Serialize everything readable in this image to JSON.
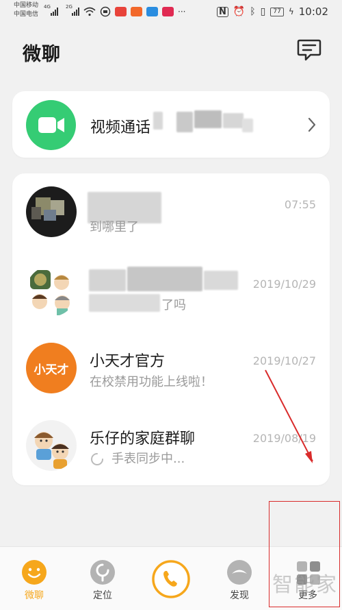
{
  "status_bar": {
    "carrier_1": "中国移动",
    "carrier_2": "中国电信",
    "network_1": "4G",
    "network_2": "2G",
    "more": "···",
    "battery": "77",
    "time": "10:02"
  },
  "header": {
    "title": "微聊",
    "compose_icon": "message-compose-icon"
  },
  "video_call": {
    "label": "视频通话",
    "icon": "video-camera-icon",
    "accent": "#35cc74"
  },
  "chats": [
    {
      "name": "",
      "last_message": "到哪里了",
      "time": "07:55"
    },
    {
      "name": "",
      "last_message": "了吗",
      "time": "2019/10/29"
    },
    {
      "name": "小天才官方",
      "last_message": "在校禁用功能上线啦！",
      "time": "2019/10/27",
      "avatar_text": "小天才",
      "avatar_color": "#f07e1f"
    },
    {
      "name": "乐仔的家庭群聊",
      "last_message": "手表同步中...",
      "time": "2019/08/19"
    }
  ],
  "tabbar": {
    "tabs": [
      {
        "label": "微聊",
        "icon": "smile-icon",
        "active": true
      },
      {
        "label": "定位",
        "icon": "location-icon",
        "active": false
      },
      {
        "label": "",
        "icon": "phone-icon",
        "active": false
      },
      {
        "label": "发现",
        "icon": "discover-icon",
        "active": false
      },
      {
        "label": "更多",
        "icon": "more-grid-icon",
        "active": false
      }
    ],
    "active_color": "#f6a71c"
  },
  "watermark": "智能家",
  "annotation_color": "#d92b2b"
}
